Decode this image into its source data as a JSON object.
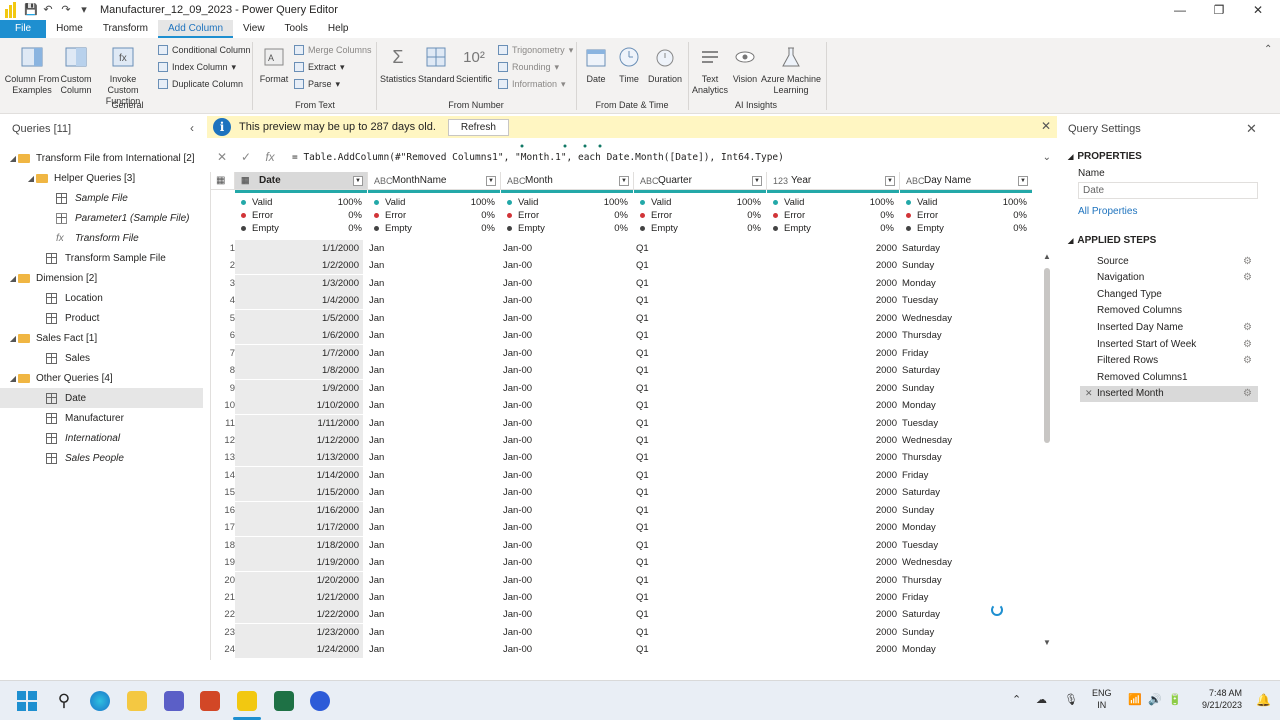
{
  "window": {
    "title": "Manufacturer_12_09_2023 - Power Query Editor"
  },
  "menu_tabs": [
    "File",
    "Home",
    "Transform",
    "Add Column",
    "View",
    "Tools",
    "Help"
  ],
  "ribbon": {
    "general": {
      "column_from_examples": "Column From\nExamples",
      "custom_column": "Custom\nColumn",
      "invoke_custom_function": "Invoke Custom\nFunction",
      "conditional_column": "Conditional Column",
      "index_column": "Index Column",
      "duplicate_column": "Duplicate Column",
      "group_label": "General"
    },
    "from_text": {
      "format": "Format",
      "merge_columns": "Merge Columns",
      "extract": "Extract",
      "parse": "Parse",
      "group_label": "From Text"
    },
    "from_number": {
      "statistics": "Statistics",
      "standard": "Standard",
      "scientific": "Scientific",
      "trigonometry": "Trigonometry",
      "rounding": "Rounding",
      "information": "Information",
      "group_label": "From Number"
    },
    "from_date_time": {
      "date": "Date",
      "time": "Time",
      "duration": "Duration",
      "group_label": "From Date & Time"
    },
    "ai_insights": {
      "text_analytics": "Text\nAnalytics",
      "vision": "Vision",
      "azure_ml": "Azure Machine\nLearning",
      "group_label": "AI Insights"
    }
  },
  "queries": {
    "header": "Queries [11]",
    "items": [
      {
        "label": "Transform File from International [2]",
        "type": "folder",
        "level": 0
      },
      {
        "label": "Helper Queries [3]",
        "type": "folder",
        "level": 1
      },
      {
        "label": "Sample File",
        "type": "table",
        "level": 2,
        "italic": true
      },
      {
        "label": "Parameter1 (Sample File)",
        "type": "param",
        "level": 2,
        "italic": true
      },
      {
        "label": "Transform File",
        "type": "fx",
        "level": 2,
        "italic": true
      },
      {
        "label": "Transform Sample File",
        "type": "table",
        "level": 1
      },
      {
        "label": "Dimension [2]",
        "type": "folder",
        "level": 0
      },
      {
        "label": "Location",
        "type": "table",
        "level": 1
      },
      {
        "label": "Product",
        "type": "table",
        "level": 1
      },
      {
        "label": "Sales Fact [1]",
        "type": "folder",
        "level": 0
      },
      {
        "label": "Sales",
        "type": "table",
        "level": 1
      },
      {
        "label": "Other Queries [4]",
        "type": "folder",
        "level": 0
      },
      {
        "label": "Date",
        "type": "table",
        "level": 1,
        "selected": true
      },
      {
        "label": "Manufacturer",
        "type": "table",
        "level": 1
      },
      {
        "label": "International",
        "type": "table",
        "level": 1,
        "italic": true
      },
      {
        "label": "Sales People",
        "type": "table",
        "level": 1,
        "italic": true
      }
    ]
  },
  "banner": {
    "message": "This preview may be up to 287 days old.",
    "refresh": "Refresh"
  },
  "formula": "= Table.AddColumn(#\"Removed Columns1\", \"Month.1\", each Date.Month([Date]), Int64.Type)",
  "columns": [
    {
      "name": "Date",
      "type_icon": "▦"
    },
    {
      "name": "MonthName",
      "type_icon": "ABC"
    },
    {
      "name": "Month",
      "type_icon": "ABC"
    },
    {
      "name": "Quarter",
      "type_icon": "ABC"
    },
    {
      "name": "Year",
      "type_icon": "123"
    },
    {
      "name": "Day Name",
      "type_icon": "ABC"
    }
  ],
  "quality": {
    "valid": "Valid",
    "error": "Error",
    "empty": "Empty",
    "valid_pct": "100%",
    "error_pct": "0%",
    "empty_pct": "0%"
  },
  "rows": [
    [
      "1",
      "1/1/2000",
      "Jan",
      "Jan-00",
      "Q1",
      "2000",
      "Saturday"
    ],
    [
      "2",
      "1/2/2000",
      "Jan",
      "Jan-00",
      "Q1",
      "2000",
      "Sunday"
    ],
    [
      "3",
      "1/3/2000",
      "Jan",
      "Jan-00",
      "Q1",
      "2000",
      "Monday"
    ],
    [
      "4",
      "1/4/2000",
      "Jan",
      "Jan-00",
      "Q1",
      "2000",
      "Tuesday"
    ],
    [
      "5",
      "1/5/2000",
      "Jan",
      "Jan-00",
      "Q1",
      "2000",
      "Wednesday"
    ],
    [
      "6",
      "1/6/2000",
      "Jan",
      "Jan-00",
      "Q1",
      "2000",
      "Thursday"
    ],
    [
      "7",
      "1/7/2000",
      "Jan",
      "Jan-00",
      "Q1",
      "2000",
      "Friday"
    ],
    [
      "8",
      "1/8/2000",
      "Jan",
      "Jan-00",
      "Q1",
      "2000",
      "Saturday"
    ],
    [
      "9",
      "1/9/2000",
      "Jan",
      "Jan-00",
      "Q1",
      "2000",
      "Sunday"
    ],
    [
      "10",
      "1/10/2000",
      "Jan",
      "Jan-00",
      "Q1",
      "2000",
      "Monday"
    ],
    [
      "11",
      "1/11/2000",
      "Jan",
      "Jan-00",
      "Q1",
      "2000",
      "Tuesday"
    ],
    [
      "12",
      "1/12/2000",
      "Jan",
      "Jan-00",
      "Q1",
      "2000",
      "Wednesday"
    ],
    [
      "13",
      "1/13/2000",
      "Jan",
      "Jan-00",
      "Q1",
      "2000",
      "Thursday"
    ],
    [
      "14",
      "1/14/2000",
      "Jan",
      "Jan-00",
      "Q1",
      "2000",
      "Friday"
    ],
    [
      "15",
      "1/15/2000",
      "Jan",
      "Jan-00",
      "Q1",
      "2000",
      "Saturday"
    ],
    [
      "16",
      "1/16/2000",
      "Jan",
      "Jan-00",
      "Q1",
      "2000",
      "Sunday"
    ],
    [
      "17",
      "1/17/2000",
      "Jan",
      "Jan-00",
      "Q1",
      "2000",
      "Monday"
    ],
    [
      "18",
      "1/18/2000",
      "Jan",
      "Jan-00",
      "Q1",
      "2000",
      "Tuesday"
    ],
    [
      "19",
      "1/19/2000",
      "Jan",
      "Jan-00",
      "Q1",
      "2000",
      "Wednesday"
    ],
    [
      "20",
      "1/20/2000",
      "Jan",
      "Jan-00",
      "Q1",
      "2000",
      "Thursday"
    ],
    [
      "21",
      "1/21/2000",
      "Jan",
      "Jan-00",
      "Q1",
      "2000",
      "Friday"
    ],
    [
      "22",
      "1/22/2000",
      "Jan",
      "Jan-00",
      "Q1",
      "2000",
      "Saturday"
    ],
    [
      "23",
      "1/23/2000",
      "Jan",
      "Jan-00",
      "Q1",
      "2000",
      "Sunday"
    ],
    [
      "24",
      "1/24/2000",
      "Jan",
      "Jan-00",
      "Q1",
      "2000",
      "Monday"
    ]
  ],
  "query_settings": {
    "title": "Query Settings",
    "properties_label": "PROPERTIES",
    "name_label": "Name",
    "name_value": "Date",
    "all_properties": "All Properties",
    "applied_steps_label": "APPLIED STEPS",
    "steps": [
      {
        "label": "Source",
        "gear": true
      },
      {
        "label": "Navigation",
        "gear": true
      },
      {
        "label": "Changed Type",
        "gear": false
      },
      {
        "label": "Removed Columns",
        "gear": false
      },
      {
        "label": "Inserted Day Name",
        "gear": true
      },
      {
        "label": "Inserted Start of Week",
        "gear": true
      },
      {
        "label": "Filtered Rows",
        "gear": true
      },
      {
        "label": "Removed Columns1",
        "gear": false
      },
      {
        "label": "Inserted Month",
        "gear": true,
        "selected": true
      }
    ]
  },
  "taskbar": {
    "lang": "ENG",
    "region": "IN",
    "time": "7:48 AM",
    "date": "9/21/2023"
  },
  "colors": {
    "accent": "#1e8fd0",
    "quality_valid": "#23a8a8",
    "quality_error": "#d13438",
    "quality_empty": "#444444",
    "folder": "#f0b643",
    "banner": "#fff6c2"
  }
}
